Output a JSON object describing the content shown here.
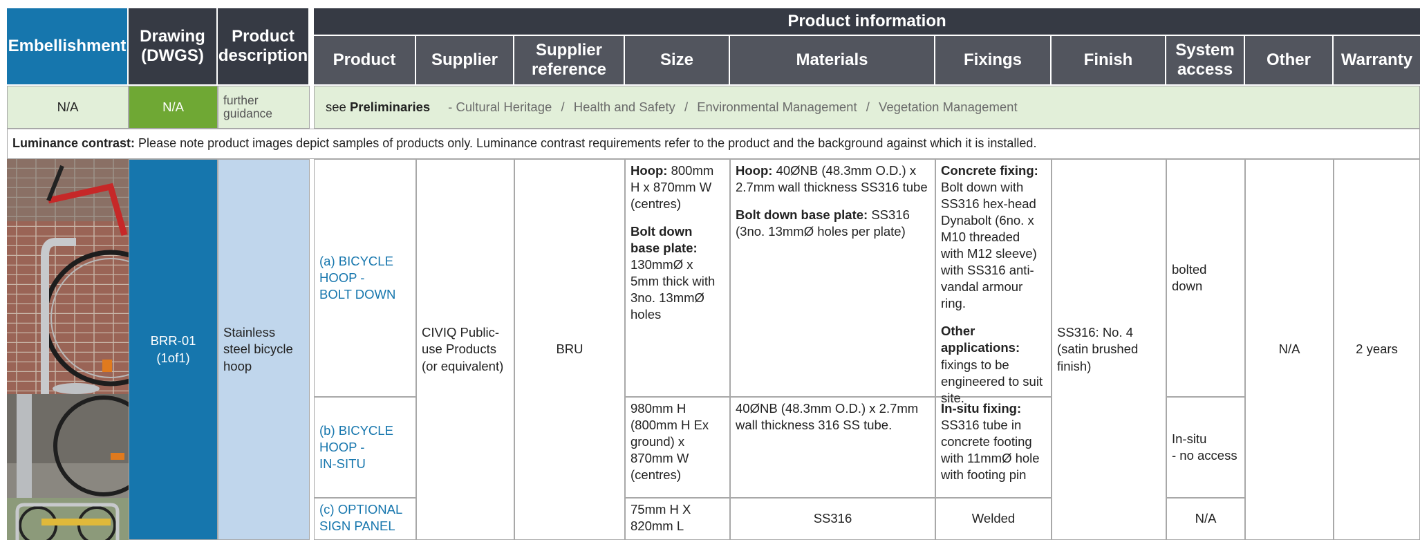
{
  "header": {
    "embellishment": "Embellishment",
    "drawing": "Drawing (DWGS)",
    "product_description": "Product description",
    "product_information": "Product information",
    "columns": [
      "Product",
      "Supplier",
      "Supplier reference",
      "Size",
      "Materials",
      "Fixings",
      "Finish",
      "System access",
      "Other",
      "Warranty"
    ]
  },
  "prelim_row": {
    "embellishment": "N/A",
    "drawing": "N/A",
    "guidance": "further guidance",
    "see": "see",
    "preliminaries": "Preliminaries",
    "links": [
      "- Cultural Heritage",
      "/",
      "Health and Safety",
      "/",
      "Environmental Management",
      "/",
      "Vegetation Management"
    ]
  },
  "luminance": {
    "label": "Luminance contrast:",
    "text": "Please note product images depict samples of products only. Luminance contrast requirements refer to the product and the background against which it is installed."
  },
  "item": {
    "drawing": "BRR-01",
    "drawing_sub": "(1of1)",
    "description": "Stainless steel bicycle hoop",
    "supplier": "CIVIQ Public-use Products (or equivalent)",
    "supplier_ref": "BRU",
    "finish": "SS316: No. 4 (satin brushed finish)",
    "other": "N/A",
    "warranty": "2 years",
    "rows": [
      {
        "product": [
          "(a) BICYCLE",
          "HOOP -",
          "BOLT DOWN"
        ],
        "size_a_label": "Hoop:",
        "size_a_text": "800mm H x 870mm W (centres)",
        "size_b_label": "Bolt down base plate:",
        "size_b_text": "130mmØ x 5mm thick with 3no. 13mmØ holes",
        "mat_a_label": "Hoop:",
        "mat_a_text": "40ØNB (48.3mm O.D.) x 2.7mm wall thickness SS316 tube",
        "mat_b_label": "Bolt down base plate:",
        "mat_b_text": "SS316 (3no. 13mmØ holes per plate)",
        "fix_a_label": "Concrete fixing:",
        "fix_a_text": "Bolt down with SS316 hex-head Dynabolt (6no. x M10 threaded with M12 sleeve) with SS316 anti-vandal armour ring.",
        "fix_b_label": "Other applications:",
        "fix_b_text": "fixings to be engineered to suit site.",
        "access": "bolted down"
      },
      {
        "product": [
          "(b) BICYCLE",
          "HOOP -",
          "IN-SITU"
        ],
        "size_text": "980mm H (800mm H Ex ground) x 870mm W (centres)",
        "mat_text": "40ØNB (48.3mm O.D.) x 2.7mm wall thickness 316 SS tube.",
        "fix_label": "In-situ fixing:",
        "fix_text": "SS316 tube in concrete footing with 11mmØ hole with footing pin",
        "access_a": "In-situ",
        "access_b": "- no access"
      },
      {
        "product": [
          "(c) OPTIONAL",
          "SIGN PANEL"
        ],
        "size_text": "75mm H X 820mm L",
        "mat_text": "SS316",
        "fix_text": "Welded",
        "access": "N/A"
      }
    ]
  },
  "colors": {
    "header_dark": "#52555e",
    "header_darker": "#363a44",
    "embellishment_blue": "#1676ad",
    "drawing_green": "#6fa834",
    "prelim_green": "#e2efd9",
    "description_blue": "#c0d6ec"
  }
}
